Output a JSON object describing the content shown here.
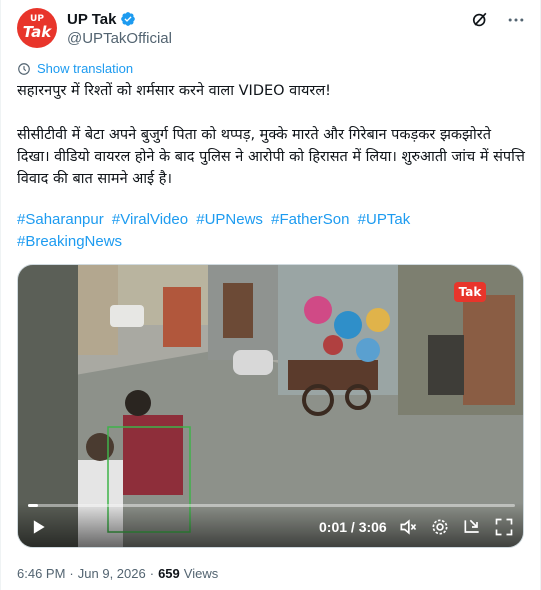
{
  "account": {
    "display_name": "UP Tak",
    "handle": "@UPTakOfficial",
    "avatar_line1": "UP",
    "avatar_line2": "Tak",
    "verified_color": "#1d9bf0",
    "avatar_color": "#e8352b"
  },
  "header_icons": [
    "grok-icon",
    "more-icon"
  ],
  "translate_label": "Show translation",
  "tweet": {
    "headline": "सहारनपुर में रिश्तों को शर्मसार करने वाला VIDEO वायरल!",
    "body": "सीसीटीवी में बेटा अपने बुजुर्ग पिता को थप्पड़, मुक्के मारते और गिरेबान पकड़कर झकझोरते दिखा। वीडियो वायरल होने के बाद पुलिस ने आरोपी को हिरासत में लिया। शुरुआती जांच में संपत्ति विवाद की बात सामने आई है।",
    "hashtags": [
      "#Saharanpur",
      "#ViralVideo",
      "#UPNews",
      "#FatherSon",
      "#UPTak",
      "#BreakingNews"
    ]
  },
  "video": {
    "watermark": "Tak",
    "time_display": "0:01 / 3:06",
    "progress_fraction": 0.005,
    "controls": [
      "play-icon",
      "volume-icon",
      "settings-icon",
      "picture-in-picture-icon",
      "fullscreen-icon"
    ]
  },
  "meta": {
    "time": "6:46 PM",
    "separator": "·",
    "date": "Jun 9, 2026",
    "views_count": "659",
    "views_label": "Views"
  },
  "colors": {
    "link": "#1d9bf0",
    "secondary_text": "#536471",
    "primary_text": "#0f1419",
    "border": "#cfd9de"
  }
}
